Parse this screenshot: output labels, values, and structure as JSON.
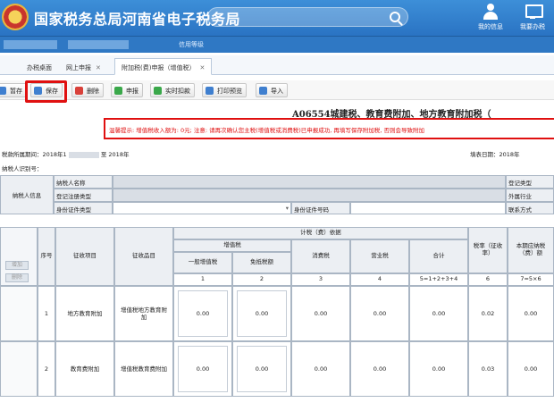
{
  "header": {
    "site_title": "国家税务总局河南省电子税务局",
    "my_info": "我的信息",
    "my_office": "我要办税"
  },
  "subbar": {
    "credit_label": "信用等级"
  },
  "tabs": [
    {
      "label": "办税桌面"
    },
    {
      "label": "网上申报"
    },
    {
      "label": "附加税(费)申报（增值税）"
    }
  ],
  "toolbar": {
    "draft": "暂存",
    "save": "保存",
    "delete": "删除",
    "declare": "申报",
    "realtime_deduct": "实时扣款",
    "print_preview": "打印预览",
    "import": "导入"
  },
  "form": {
    "title": "A06554城建税、教育费附加、地方教育附加税（",
    "warning": "温馨提示:     增值税收入额为: 0元; 注意: 请再次确认您主税(增值税或消费税)已申报成功, 再填写保存附加税, 否则会导致附加",
    "period_label": "税款所属期间：2018年1",
    "period_to": "至  2018年",
    "fill_date": "填表日期：2018年",
    "taxid_label": "纳税人识别号："
  },
  "info_table": {
    "taxpayer_info": "纳税人信息",
    "name_label": "纳税人名称",
    "reg_type_label": "登记注册类型",
    "id_type_label": "身份证件类型",
    "id_number_label": "身份证件号码",
    "right_reg_type": "登记类型",
    "right_foreign": "外属行业",
    "right_contact": "联系方式"
  },
  "grid": {
    "add_btn": "增加",
    "del_btn": "删除",
    "seq": "序号",
    "tax_item": "征收项目",
    "tax_subitem": "征收品目",
    "basis": "计税（费）依据",
    "vat": "增值税",
    "general_vat": "一般增值税",
    "exempt_vat": "免抵税额",
    "consumption": "消费税",
    "business": "营业税",
    "total": "合计",
    "rate": "税率（征收率）",
    "payable": "本期应纳税（费）额",
    "col_nums": [
      "1",
      "2",
      "3",
      "4",
      "5=1+2+3+4",
      "6",
      "7=5×6"
    ],
    "rows": [
      {
        "seq": "1",
        "item": "地方教育附加",
        "subitem": "增值税地方教育附加",
        "v1": "0.00",
        "v2": "0.00",
        "v3": "0.00",
        "v4": "0.00",
        "total": "0.00",
        "rate": "0.02",
        "payable": "0.00"
      },
      {
        "seq": "2",
        "item": "教育费附加",
        "subitem": "增值税教育费附加",
        "v1": "0.00",
        "v2": "0.00",
        "v3": "0.00",
        "v4": "0.00",
        "total": "0.00",
        "rate": "0.03",
        "payable": "0.00"
      }
    ]
  },
  "colors": {
    "header_blue": "#2a73c3",
    "highlight_red": "#e01010"
  }
}
